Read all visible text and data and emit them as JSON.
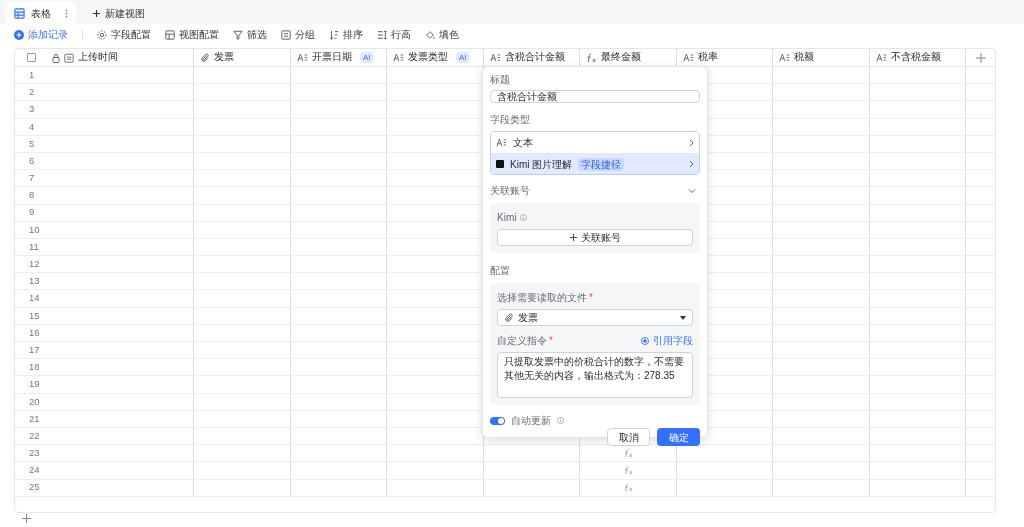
{
  "tabs": [
    {
      "label": "表格",
      "selected": true
    }
  ],
  "new_view": "新建视图",
  "toolbar": {
    "add_record": "添加记录",
    "items": [
      {
        "kind": "gear",
        "label": "字段配置"
      },
      {
        "kind": "view",
        "label": "视图配置"
      },
      {
        "kind": "filter",
        "label": "筛选"
      },
      {
        "kind": "group",
        "label": "分组"
      },
      {
        "kind": "sort",
        "label": "排序"
      },
      {
        "kind": "height",
        "label": "行高"
      },
      {
        "kind": "color",
        "label": "填色"
      }
    ]
  },
  "table": {
    "columns": [
      {
        "kind": "time",
        "label": "上传时间",
        "ai": false
      },
      {
        "kind": "attach",
        "label": "发票",
        "ai": false
      },
      {
        "kind": "text",
        "label": "开票日期",
        "ai": true,
        "badge": "AI"
      },
      {
        "kind": "text",
        "label": "发票类型",
        "ai": true,
        "badge": "AI"
      },
      {
        "kind": "text",
        "label": "含税合计金额",
        "ai": false
      },
      {
        "kind": "formula",
        "label": "最终金额",
        "ai": false
      },
      {
        "kind": "text",
        "label": "税率",
        "ai": false
      },
      {
        "kind": "text",
        "label": "税额",
        "ai": false
      },
      {
        "kind": "text",
        "label": "不含税金额",
        "ai": false
      }
    ],
    "select_all_checked": false,
    "rows": [
      {
        "number": "1"
      },
      {
        "number": "2"
      },
      {
        "number": "3"
      },
      {
        "number": "4"
      },
      {
        "number": "5"
      },
      {
        "number": "6"
      },
      {
        "number": "7"
      },
      {
        "number": "8"
      },
      {
        "number": "9"
      },
      {
        "number": "10"
      },
      {
        "number": "11"
      },
      {
        "number": "12"
      },
      {
        "number": "13"
      },
      {
        "number": "14"
      },
      {
        "number": "15"
      },
      {
        "number": "16"
      },
      {
        "number": "17"
      },
      {
        "number": "18"
      },
      {
        "number": "19"
      },
      {
        "number": "20"
      },
      {
        "number": "21"
      },
      {
        "number": "22"
      },
      {
        "number": "23",
        "final_amount": {
          "kind": "formula"
        }
      },
      {
        "number": "24",
        "final_amount": {
          "kind": "formula"
        }
      },
      {
        "number": "25",
        "final_amount": {
          "kind": "formula"
        }
      }
    ]
  },
  "field_popup": {
    "title_label": "标题",
    "title_value": "含税合计金额",
    "type_label": "字段类型",
    "types": [
      {
        "kind": "text",
        "label": "文本",
        "selected": false
      },
      {
        "kind": "kimi",
        "label": "Kimi 图片理解",
        "tag": "字段捷径",
        "selected": true
      }
    ],
    "account_label": "关联账号",
    "account_expanded": true,
    "account_name": "Kimi",
    "link_account": "关联账号",
    "config_label": "配置",
    "file_label": "选择需要读取的文件",
    "file_required_mark": "*",
    "prompt_required_mark": "*",
    "file_value": "发票",
    "prompt_label": "自定义指令",
    "reference_field": "引用字段",
    "prompt_value": "只提取发票中的价税合计的数字，不需要其他无关的内容，输出格式为：278.35",
    "auto_update": {
      "label": "自动更新",
      "on": true
    },
    "cancel": "取消",
    "confirm": "确定"
  }
}
